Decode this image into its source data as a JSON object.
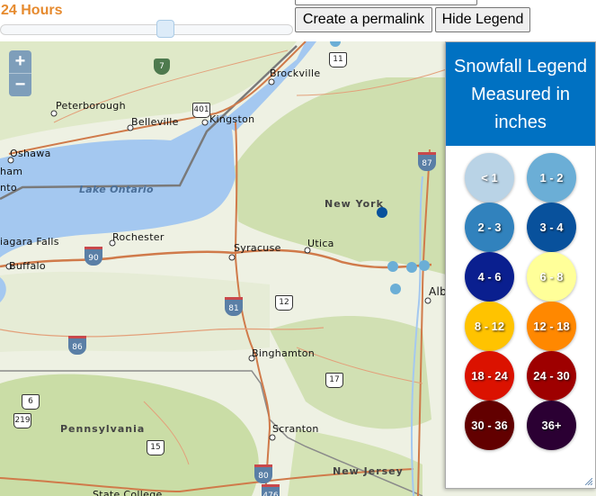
{
  "header": {
    "time_window_label": "24 Hours",
    "time_slider_position_fraction": 0.57,
    "permalink_button": "Create a permalink",
    "hide_legend_button": "Hide Legend"
  },
  "map": {
    "zoom_in": "+",
    "zoom_out": "−",
    "labels": {
      "peterborough": "Peterborough",
      "belleville": "Belleville",
      "kingston": "Kingston",
      "brockville": "Brockville",
      "oshawa": "Oshawa",
      "toronto_partial": "nto",
      "markham_partial": "ham",
      "lake_ontario": "Lake Ontario",
      "new_york": "New York",
      "rochester": "Rochester",
      "niagara_falls": "iagara Falls",
      "buffalo": "Buffalo",
      "syracuse": "Syracuse",
      "utica": "Utica",
      "albany_partial": "Alb",
      "binghamton": "Binghamton",
      "pennsylvania": "Pennsylvania",
      "scranton": "Scranton",
      "new_jersey": "New Jersey",
      "state_college_partial": "State College"
    },
    "shields": {
      "hwy_7": "7",
      "hwy_401": "401",
      "us_11": "11",
      "i_87": "87",
      "i_90": "90",
      "i_81": "81",
      "us_12": "12",
      "i_86": "86",
      "us_6": "6",
      "us_219": "219",
      "us_15": "15",
      "rt_17": "17",
      "i_80": "80",
      "i_476": "476"
    },
    "observations": [
      {
        "category": "3 - 4",
        "color": "#08519c"
      },
      {
        "category": "1 - 2",
        "color": "#6baed6"
      },
      {
        "category": "1 - 2",
        "color": "#6baed6"
      },
      {
        "category": "1 - 2",
        "color": "#6baed6"
      },
      {
        "category": "1 - 2",
        "color": "#6baed6"
      },
      {
        "category": "1 - 2",
        "color": "#6baed6"
      }
    ]
  },
  "legend": {
    "title": "Snowfall Legend Measured in inches",
    "items": [
      {
        "label": "< 1",
        "color": "#b9d3e6"
      },
      {
        "label": "1 - 2",
        "color": "#6baed6"
      },
      {
        "label": "2 - 3",
        "color": "#3182bd"
      },
      {
        "label": "3 - 4",
        "color": "#08519c"
      },
      {
        "label": "4 - 6",
        "color": "#0a1f8f"
      },
      {
        "label": "6 - 8",
        "color": "#ffff99"
      },
      {
        "label": "8 - 12",
        "color": "#ffc300"
      },
      {
        "label": "12 - 18",
        "color": "#ff8800"
      },
      {
        "label": "18 - 24",
        "color": "#db1200"
      },
      {
        "label": "24 - 30",
        "color": "#9e0000"
      },
      {
        "label": "30 - 36",
        "color": "#620000"
      },
      {
        "label": "36+",
        "color": "#2b0033"
      }
    ]
  }
}
